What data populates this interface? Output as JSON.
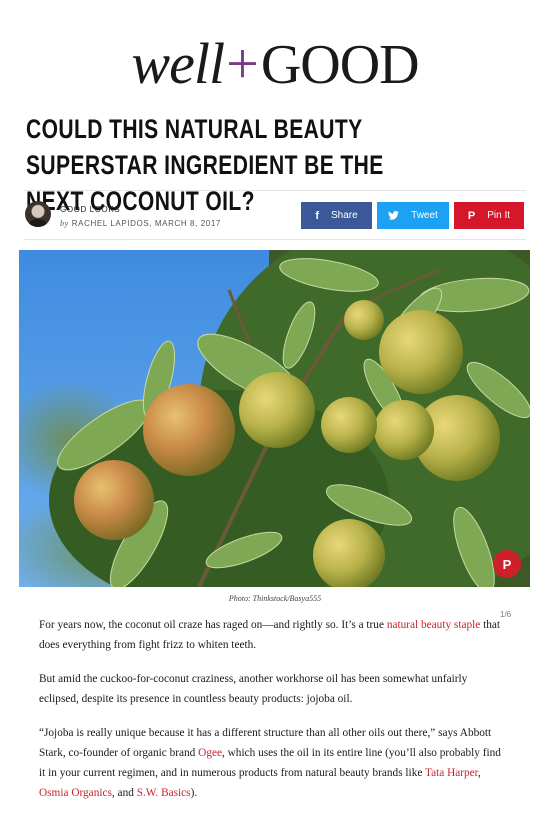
{
  "brand": {
    "left": "well",
    "plus": "+",
    "right": "GOOD"
  },
  "article": {
    "headline": "Could This Natural Beauty Superstar Ingredient Be the Next Coconut Oil?",
    "section": "GOOD LOOKS",
    "byline_prefix": "by",
    "author": "RACHEL LAPIDOS",
    "date": "MARCH 8, 2017",
    "share": {
      "facebook": "Share",
      "twitter": "Tweet",
      "pinterest": "Pin It"
    },
    "photo_caption": "Photo: Thinkstock/Basya555",
    "slide_counter": "1/6",
    "p1": {
      "before": "For years now, the coconut oil craze has raged on—and rightly so. It’s a true ",
      "link": "natural beauty staple",
      "after": " that does everything from fight frizz to whiten teeth."
    },
    "p2": "But amid the cuckoo-for-coconut craziness, another workhorse oil has been somewhat unfairly eclipsed, despite its presence in countless beauty products: jojoba oil.",
    "p3": {
      "t1": "“Jojoba is really unique because it has a different structure than all other oils out there,” says Abbott Stark, co-founder of organic brand ",
      "l1": "Ogee",
      "t2": ", which uses the oil in its entire line (you’ll also probably find it in your current regimen, and in numerous products from natural beauty brands like ",
      "l2": "Tata Harper",
      "t3": ", ",
      "l3": "Osmia Organics",
      "t4": ", and ",
      "l4": "S.W. Basics",
      "t5": ")."
    }
  },
  "colors": {
    "facebook": "#3b5998",
    "twitter": "#1da1f2",
    "pinterest": "#d5172b",
    "link": "#c8232c",
    "brand_plus": "#7b3a86"
  }
}
